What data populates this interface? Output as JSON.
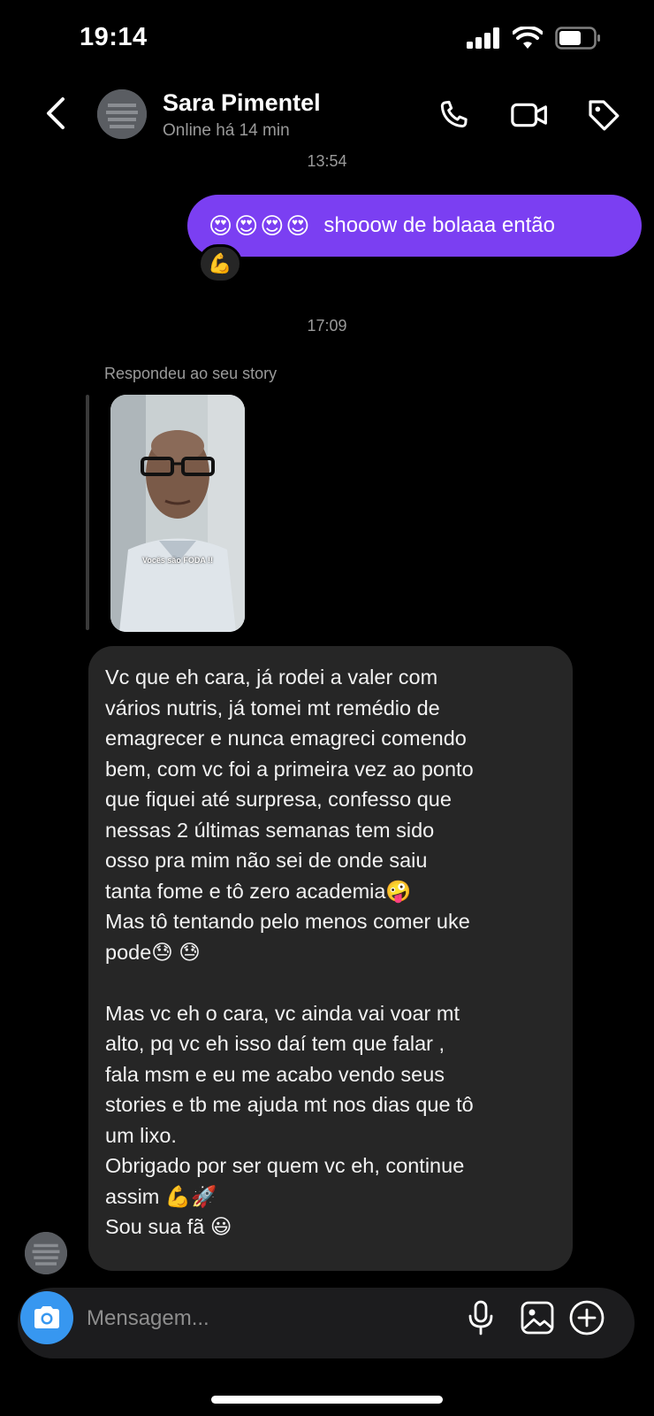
{
  "status_bar": {
    "time": "19:14"
  },
  "header": {
    "contact_name": "Sara Pimentel",
    "contact_status": "Online há 14 min",
    "icons": [
      "back-icon",
      "phone-icon",
      "video-icon",
      "tag-icon"
    ]
  },
  "messages": {
    "timestamp_1": "13:54",
    "outgoing_emojis": "😍😍😍😍",
    "outgoing_text": "shooow de bolaaa então",
    "outgoing_reaction": "💪",
    "timestamp_2": "17:09",
    "reply_label": "Respondeu ao seu story",
    "story_caption": "Vocês são FODA !!",
    "incoming_text": "Vc que eh cara, já rodei a valer com\nvários nutris, já tomei mt remédio de\nemagrecer e nunca emagreci comendo\nbem, com vc foi a primeira vez ao ponto\nque fiquei até surpresa, confesso que\nnessas 2 últimas semanas tem sido\nosso pra mim não sei de onde saiu\ntanta fome e tô zero academia🤪\nMas tô tentando pelo menos comer uke\npode😓 😓\n\nMas vc eh o cara, vc ainda vai voar mt\nalto, pq vc eh isso daí tem que falar ,\nfala msm e eu me acabo vendo seus\nstories e tb me ajuda mt nos dias que tô\num lixo.\nObrigado por ser quem vc eh, continue\nassim 💪🚀\nSou sua fã 😃"
  },
  "composer": {
    "placeholder": "Mensagem...",
    "icons": [
      "camera-icon",
      "microphone-icon",
      "gallery-icon",
      "add-icon"
    ]
  },
  "colors": {
    "outgoing_bubble": "#7b3ff2",
    "incoming_bubble": "#262626",
    "camera_button": "#3797f0",
    "background": "#000000"
  }
}
